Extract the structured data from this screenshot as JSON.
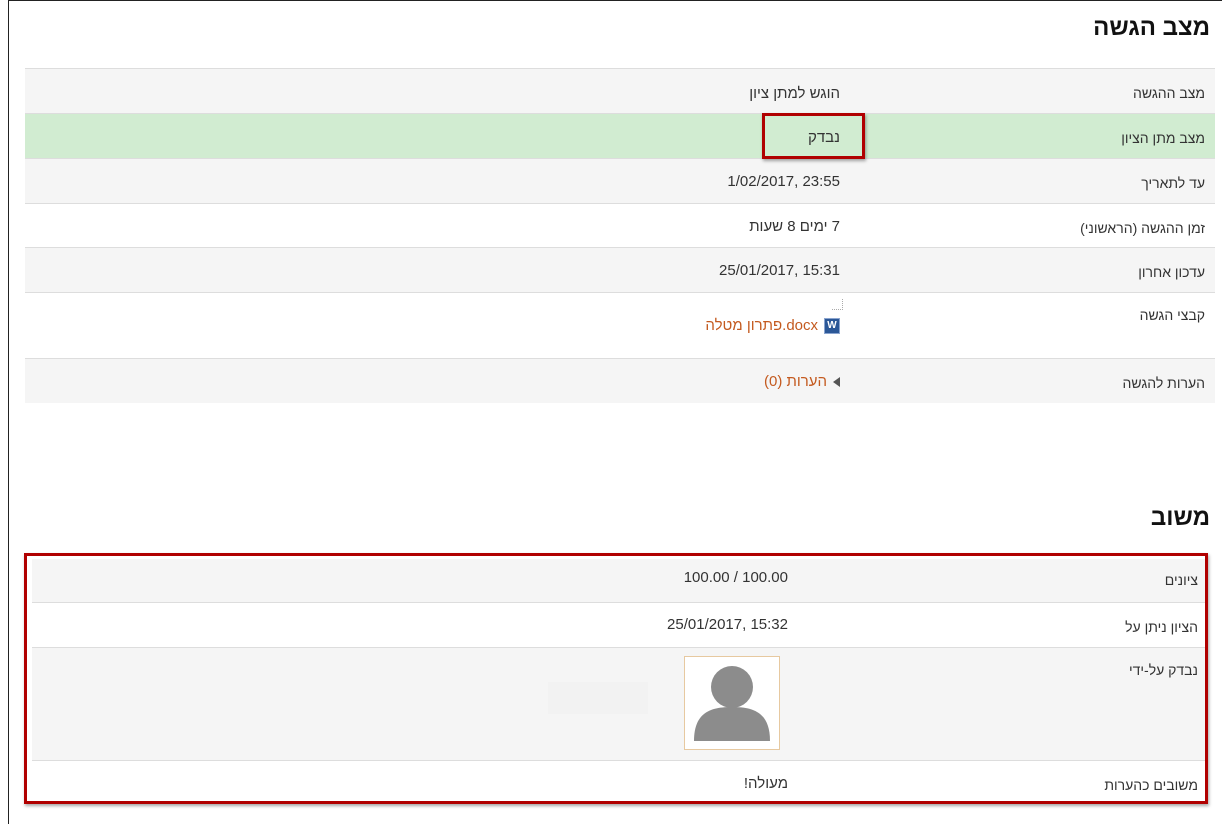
{
  "submission": {
    "title": "מצב הגשה",
    "rows": [
      {
        "label": "מצב ההגשה",
        "value": "הוגש למתן ציון"
      },
      {
        "label": "מצב מתן הציון",
        "value": "נבדק"
      },
      {
        "label": "עד לתאריך",
        "value": "23:55 ,1/02/2017"
      },
      {
        "label": "זמן ההגשה (הראשוני)",
        "value": "7 ימים 8 שעות"
      },
      {
        "label": "עדכון אחרון",
        "value": "15:31 ,25/01/2017"
      },
      {
        "label": "קבצי הגשה",
        "value": "docx.פתרון מטלה",
        "icon": "word-document-icon"
      },
      {
        "label": "הערות להגשה",
        "value": "הערות (0)",
        "icon": "collapse-triangle-icon"
      }
    ]
  },
  "feedback": {
    "title": "משוב",
    "rows": [
      {
        "label": "ציונים",
        "value": "100.00 / 100.00"
      },
      {
        "label": "הציון ניתן על",
        "value": "15:32 ,25/01/2017"
      },
      {
        "label": "נבדק על-ידי",
        "value": "",
        "icon": "user-avatar-icon"
      },
      {
        "label": "משובים כהערות",
        "value": "מעולה!"
      }
    ]
  },
  "colors": {
    "highlight_row": "#d1ecd1",
    "annotation_box": "#b00000",
    "link": "#c45a1f"
  }
}
